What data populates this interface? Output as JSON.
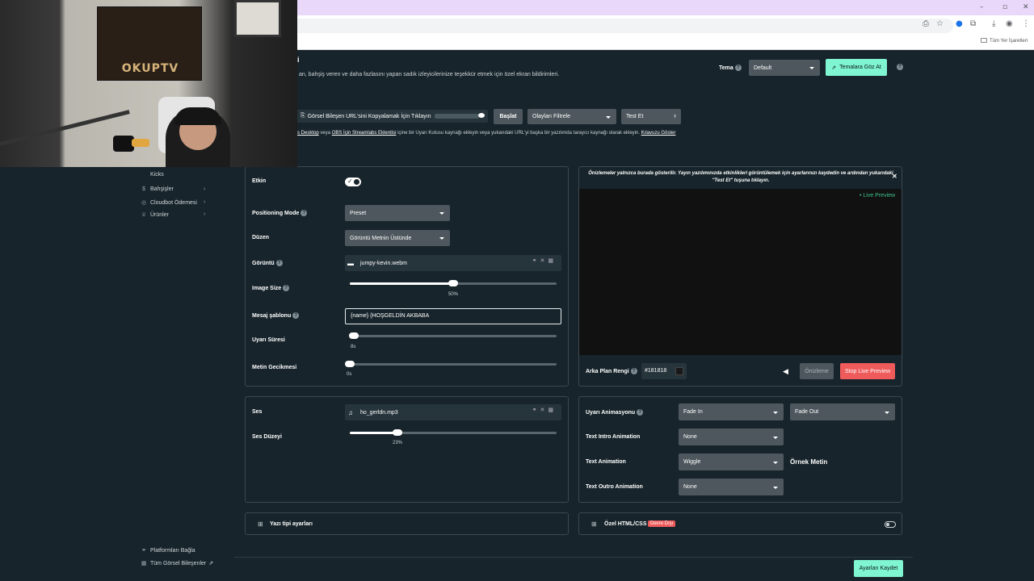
{
  "browser": {
    "bookmarks_label": "Tüm Yer İşaretleri",
    "window_controls": [
      "–",
      "▫",
      "✕"
    ]
  },
  "webcam": {
    "poster_text": "OKUPTV"
  },
  "app": {
    "title": "i",
    "description": "an, bahşiş veren ve daha fazlasını yapan sadık izleyicilerinize teşekkür etmek için özel ekran bildirimleri."
  },
  "theme": {
    "label": "Tema",
    "selected": "Default",
    "browse_button": "Temalara Göz At"
  },
  "toolbar": {
    "url_button": "Görsel Bileşen URL'sini Kopyalamak İçin Tıklayın",
    "launch_button": "Başlat",
    "filter_select": "Olayları Filtrele",
    "test_select": "Test Et"
  },
  "help": {
    "prefix": "s Desktop",
    "mid1": " veya ",
    "link2": "OBS İçin Streamlabs Eklentisi",
    "rest": " içine bir Uyarı Kutusu kaynağı ekleyin veya yukarıdaki URL'yi başka bir yazılımda tarayıcı kaynağı olarak ekleyin. ",
    "guide_link": "Kılavuzu Göster"
  },
  "sidebar": {
    "items": [
      {
        "label": "Kicks",
        "icon": "kick-icon"
      },
      {
        "label": "Bahşişler",
        "icon": "dollar-icon"
      },
      {
        "label": "Cloudbot Ödemesi",
        "icon": "bot-icon"
      },
      {
        "label": "Ürünler",
        "icon": "shirt-icon"
      }
    ],
    "footer": [
      {
        "label": "Platformları Bağla",
        "icon": "link-icon"
      },
      {
        "label": "Tüm Görsel Bileşenler",
        "icon": "widgets-icon"
      }
    ]
  },
  "settings": {
    "enabled_label": "Etkin",
    "enabled": true,
    "positioning_label": "Positioning Mode",
    "positioning_value": "Preset",
    "layout_label": "Düzen",
    "layout_value": "Görüntü Metnin Üstünde",
    "image_label": "Görüntü",
    "image_file": "jumpy-kevin.webm",
    "image_size_label": "Image Size",
    "image_size_value": "50%",
    "image_size_fraction": 0.5,
    "message_label": "Mesaj şablonu",
    "message_value": "{name}  {HOŞGELDİN AKBABA",
    "duration_label": "Uyarı Süresi",
    "duration_value": "8s",
    "duration_fraction": 0.02,
    "text_delay_label": "Metin Gecikmesi",
    "text_delay_value": "0s",
    "text_delay_fraction": 0.0
  },
  "preview": {
    "notice": "Önizlemeler yalnızca burada gösterilir. Yayın yazılımınızda etkinlikleri görüntülemek için ayarlarınızı kaydedin ve ardından yukarıdaki \"Test Et\" tuşuna tıklayın.",
    "live_badge": "• Live Preview",
    "bg_label": "Arka Plan Rengi",
    "bg_value": "#181818",
    "preview_button": "Önizleme",
    "stop_button": "Stop Live Preview"
  },
  "sound": {
    "label": "Ses",
    "file": "ho_gerldn.mp3",
    "volume_label": "Ses Düzeyi",
    "volume_value": "23%",
    "volume_fraction": 0.23
  },
  "animation": {
    "alert_label": "Uyarı Animasyonu",
    "in_value": "Fade In",
    "out_value": "Fade Out",
    "intro_label": "Text Intro Animation",
    "intro_value": "None",
    "text_label": "Text Animation",
    "text_value": "Wiggle",
    "sample_text": "Örnek Metin",
    "outro_label": "Text Outro Animation",
    "outro_value": "None"
  },
  "font_settings": {
    "label": "Yazı tipi ayarları"
  },
  "custom_html": {
    "label": "Özel HTML/CSS",
    "badge": "Devre Dışı"
  },
  "save_button": "Ayarları Kaydet"
}
